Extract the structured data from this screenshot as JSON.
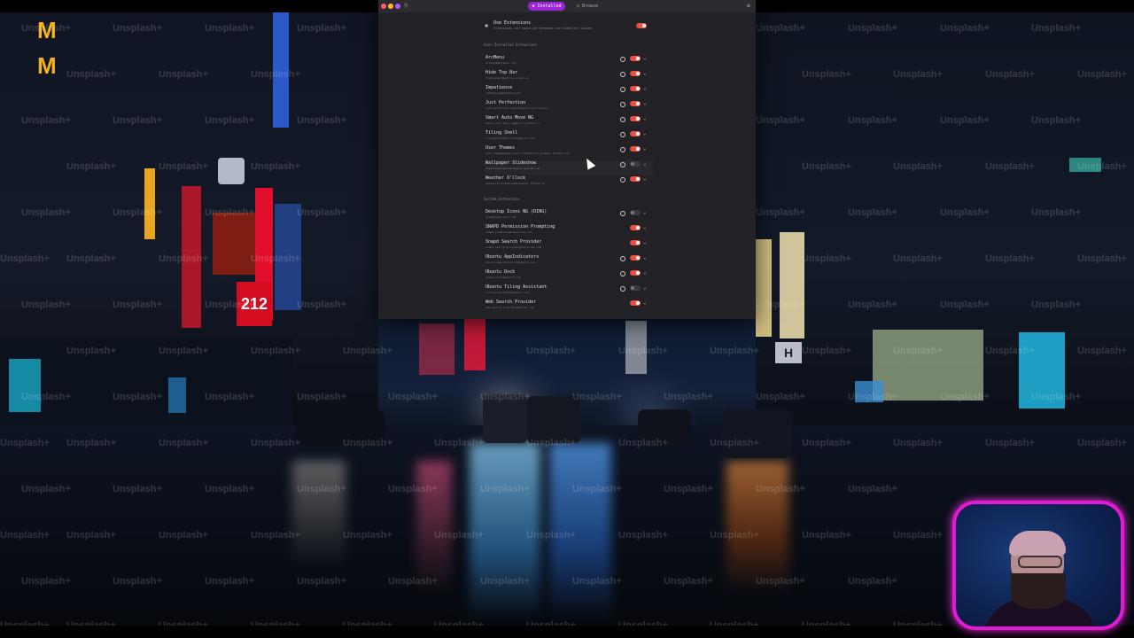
{
  "watermark": "Unsplash+",
  "tabs": {
    "installed": "Installed",
    "browse": "Browse"
  },
  "use_extensions": {
    "title": "Use Extensions",
    "subtitle": "Extensions can cause performance and stability issues",
    "enabled": true
  },
  "sections": {
    "user": "User-Installed Extensions",
    "system": "System Extensions"
  },
  "user_extensions": [
    {
      "name": "ArcMenu",
      "id": "arcmenu@arcmenu.com",
      "enabled": true
    },
    {
      "name": "Hide Top Bar",
      "id": "hidetopbar@mathieu.bidon.ca",
      "enabled": true
    },
    {
      "name": "Impatience",
      "id": "impatience@gfxmonk.net",
      "enabled": true
    },
    {
      "name": "Just Perfection",
      "id": "just-perfection-desktop@just-perfection",
      "enabled": true
    },
    {
      "name": "Smart Auto Move NG",
      "id": "smart-auto-move-ng@aylur.github.io",
      "enabled": true
    },
    {
      "name": "Tiling Shell",
      "id": "tilingshell@ferrarodomenico.com",
      "enabled": true
    },
    {
      "name": "User Themes",
      "id": "user-theme@gnome-shell-extensions.gcampax.github.com",
      "enabled": true
    },
    {
      "name": "Wallpaper Slideshow",
      "id": "azwallpaper@azwallpaper.gitlab.com",
      "enabled": false
    },
    {
      "name": "Weather O'Clock",
      "id": "weatheroclock@CleoMenezesJr.github.io",
      "enabled": true
    }
  ],
  "system_extensions": [
    {
      "name": "Desktop Icons NG (DING)",
      "id": "ding@rastersoft.com",
      "enabled": false,
      "gear": true
    },
    {
      "name": "SNAPD Permission Prompting",
      "id": "snapd-prompting@canonical.com",
      "enabled": true,
      "gear": false
    },
    {
      "name": "Snapd Search Provider",
      "id": "snapd-search-provider@canonical.com",
      "enabled": true,
      "gear": false
    },
    {
      "name": "Ubuntu AppIndicators",
      "id": "ubuntu-appindicators@ubuntu.com",
      "enabled": true,
      "gear": true
    },
    {
      "name": "Ubuntu Dock",
      "id": "ubuntu-dock@ubuntu.com",
      "enabled": true,
      "gear": true
    },
    {
      "name": "Ubuntu Tiling Assistant",
      "id": "tiling-assistant@ubuntu.com",
      "enabled": false,
      "gear": true
    },
    {
      "name": "Web Search Provider",
      "id": "web-search-provider@ubuntu.com",
      "enabled": true,
      "gear": false
    }
  ],
  "colors": {
    "accent": "#9b26d6",
    "toggle_on": "#f04c3c",
    "webcam_border": "#e21ad6"
  }
}
